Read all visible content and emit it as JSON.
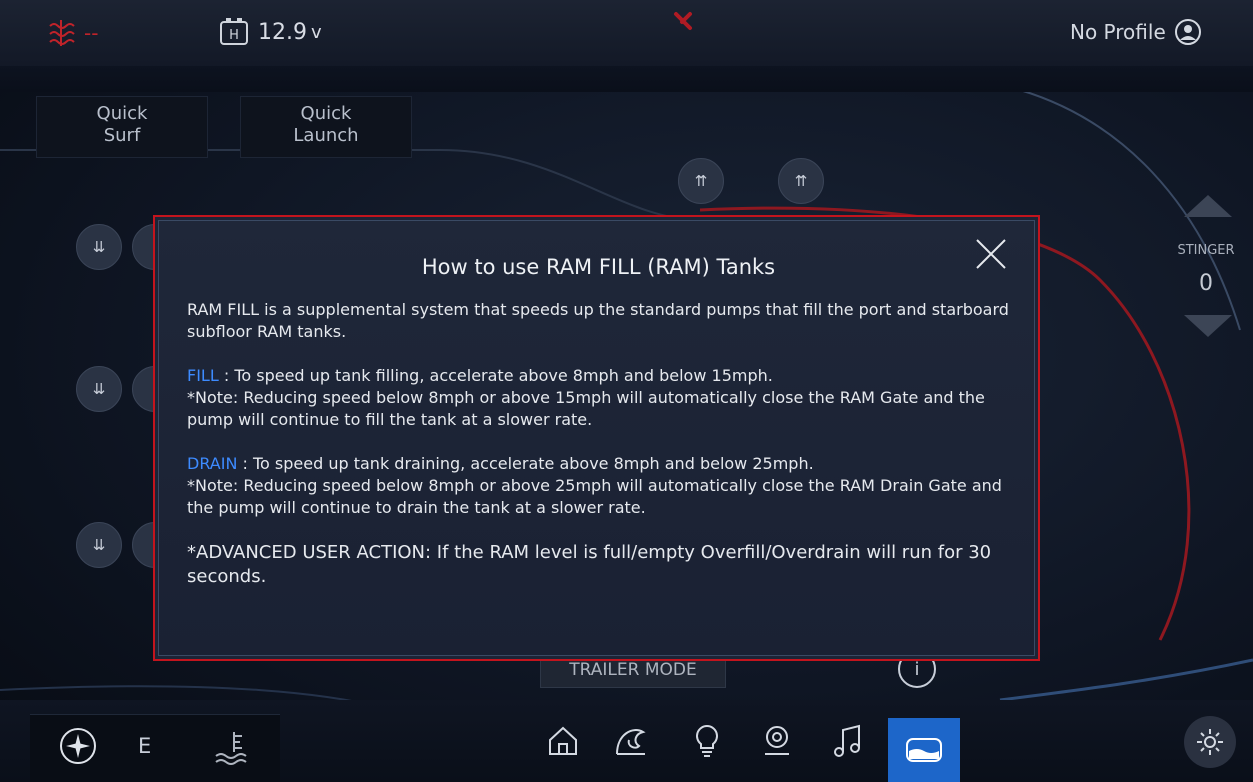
{
  "topbar": {
    "status_dash": "--",
    "battery_letter": "H",
    "voltage": "12.9",
    "voltage_unit": "v",
    "profile": "No Profile"
  },
  "quick": {
    "surf": "Quick Surf",
    "launch": "Quick Launch"
  },
  "stinger": {
    "label": "STINGER",
    "value": "0"
  },
  "trailer_mode": "TRAILER MODE",
  "bottombar": {
    "gear_letter": "E"
  },
  "modal": {
    "title": "How to use RAM FILL (RAM) Tanks",
    "intro": "RAM FILL is a supplemental system that speeds up the standard pumps that fill the port and starboard subfloor RAM tanks.",
    "fill_label": "FILL",
    "fill_text": ": To speed up tank filling, accelerate above 8mph and below 15mph.",
    "fill_note": "*Note: Reducing speed below 8mph or above 15mph will automatically close the RAM Gate and the pump will continue to fill the tank at a slower rate.",
    "drain_label": "DRAIN",
    "drain_text": ": To speed up tank draining, accelerate above 8mph and below 25mph.",
    "drain_note": "*Note: Reducing speed below 8mph or above 25mph will automatically close the RAM Drain Gate and the pump will continue to drain the tank at a slower rate.",
    "advanced": "*ADVANCED USER ACTION: If the RAM level is full/empty Overfill/Overdrain will run for 30 seconds."
  },
  "colors": {
    "accent_blue": "#3d8bff",
    "alert_red": "#c3141d",
    "active_nav": "#1d66c9"
  },
  "icons": [
    "heater-icon",
    "battery-icon",
    "warning-icon",
    "profile-icon",
    "wave-up-icon",
    "wave-down-icon",
    "compass-icon",
    "depth-icon",
    "home-icon",
    "surf-icon",
    "light-icon",
    "location-icon",
    "music-icon",
    "ballast-icon",
    "settings-icon",
    "close-icon",
    "info-icon"
  ]
}
